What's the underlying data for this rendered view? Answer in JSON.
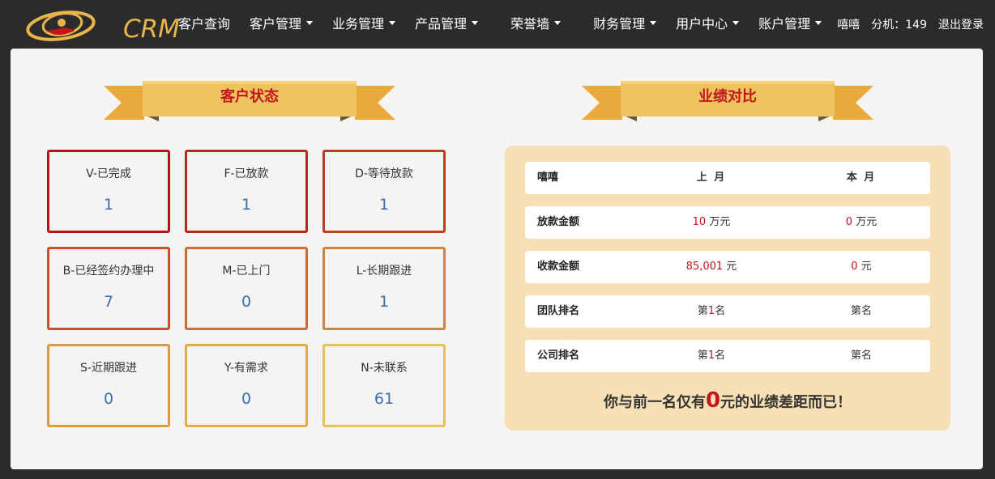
{
  "brand": {
    "name": "CRM"
  },
  "nav": {
    "items": [
      {
        "label": "客户查询",
        "dropdown": false
      },
      {
        "label": "客户管理",
        "dropdown": true
      },
      {
        "label": "业务管理",
        "dropdown": true
      },
      {
        "label": "产品管理",
        "dropdown": true
      },
      {
        "label": "荣誉墙",
        "dropdown": true
      },
      {
        "label": "财务管理",
        "dropdown": true
      },
      {
        "label": "用户中心",
        "dropdown": true
      },
      {
        "label": "账户管理",
        "dropdown": true
      }
    ]
  },
  "user": {
    "name": "嘻嘻",
    "extension": "分机：149",
    "logout": "退出登录"
  },
  "status_section": {
    "title": "客户状态",
    "cards": [
      {
        "label": "V-已完成",
        "count": "1",
        "color": "#b5121b"
      },
      {
        "label": "F-已放款",
        "count": "1",
        "color": "#b8281e"
      },
      {
        "label": "D-等待放款",
        "count": "1",
        "color": "#c03c22"
      },
      {
        "label": "B-已经签约办理中",
        "count": "7",
        "color": "#c9502a"
      },
      {
        "label": "M-已上门",
        "count": "0",
        "color": "#d06a30"
      },
      {
        "label": "L-长期跟进",
        "count": "1",
        "color": "#d5823a"
      },
      {
        "label": "S-近期跟进",
        "count": "0",
        "color": "#dc9a40"
      },
      {
        "label": "Y-有需求",
        "count": "0",
        "color": "#e2ae4a"
      },
      {
        "label": "N-未联系",
        "count": "61",
        "color": "#e8c05a"
      }
    ]
  },
  "performance_section": {
    "title": "业绩对比",
    "header": {
      "name": "嘻嘻",
      "last_month": "上 月",
      "this_month": "本 月"
    },
    "rows": [
      {
        "label": "放款金额",
        "last_value": "10",
        "last_unit": " 万元",
        "this_value": "0",
        "this_unit": " 万元"
      },
      {
        "label": "收款金额",
        "last_value": "85,001",
        "last_unit": " 元",
        "this_value": "0",
        "this_unit": " 元"
      },
      {
        "label": "团队排名",
        "last_prefix": "第",
        "last_value": "1",
        "last_unit": "名",
        "this_prefix": "第",
        "this_value": "",
        "this_unit": "名"
      },
      {
        "label": "公司排名",
        "last_prefix": "第",
        "last_value": "1",
        "last_unit": "名",
        "this_prefix": "第",
        "this_value": "",
        "this_unit": "名"
      }
    ],
    "summary": {
      "prefix": "你与前一名仅有",
      "amount": "0",
      "suffix": "元的业绩差距而已！"
    }
  },
  "colors": {
    "accent_red": "#c4151c",
    "gold": "#e8b54a",
    "panel_bg": "#f7e0b5",
    "count_blue": "#3a6fb0"
  }
}
